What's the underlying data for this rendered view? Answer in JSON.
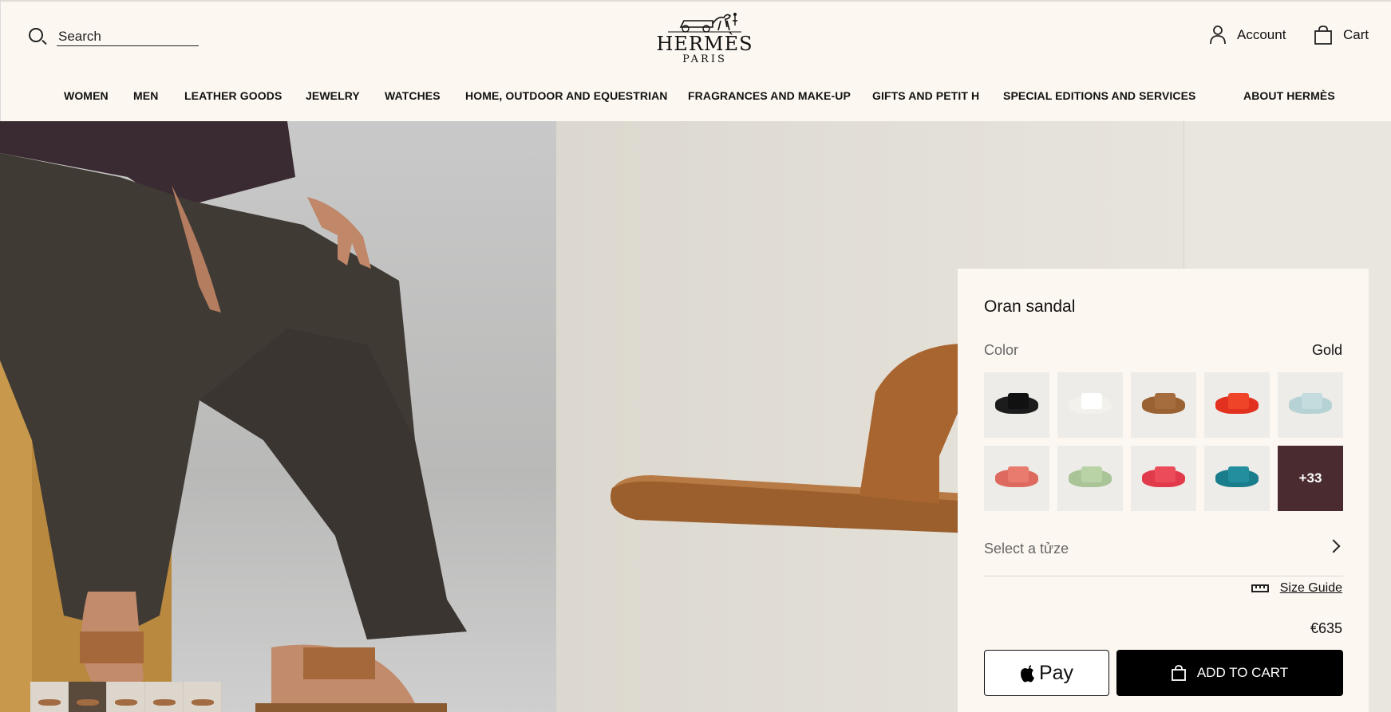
{
  "header": {
    "search_placeholder": "Search",
    "logo": {
      "brand": "HERMÈS",
      "city": "PARIS"
    },
    "account_label": "Account",
    "cart_label": "Cart"
  },
  "nav": [
    {
      "label": "WOMEN"
    },
    {
      "label": "MEN"
    },
    {
      "label": "LEATHER GOODS"
    },
    {
      "label": "JEWELRY"
    },
    {
      "label": "WATCHES"
    },
    {
      "label": "HOME, OUTDOOR AND EQUESTRIAN"
    },
    {
      "label": "FRAGRANCES AND MAKE-UP"
    },
    {
      "label": "GIFTS AND PETIT H"
    },
    {
      "label": "SPECIAL EDITIONS AND SERVICES"
    },
    {
      "label": "ABOUT HERMÈS"
    }
  ],
  "product": {
    "title": "Oran sandal",
    "color_label": "Color",
    "color_value": "Gold",
    "swatches": [
      {
        "color": "#1c1c1c",
        "strap": "#111111"
      },
      {
        "color": "#f3f1ec",
        "strap": "#ffffff"
      },
      {
        "color": "#9a6232",
        "strap": "#a56d3d"
      },
      {
        "color": "#e2321f",
        "strap": "#f04428"
      },
      {
        "color": "#b6d2d4",
        "strap": "#c4dcde"
      },
      {
        "color": "#de6a5f",
        "strap": "#e87a6e"
      },
      {
        "color": "#a9c496",
        "strap": "#b9d3a6"
      },
      {
        "color": "#e13a4a",
        "strap": "#ec4c5a"
      },
      {
        "color": "#1a7d8c",
        "strap": "#238e9e"
      }
    ],
    "more_label": "+33",
    "size_placeholder": "Select a tửze",
    "size_guide_label": "Size Guide",
    "price": "€635",
    "applepay_label": "Pay",
    "add_to_cart_label": "ADD TO CART"
  }
}
